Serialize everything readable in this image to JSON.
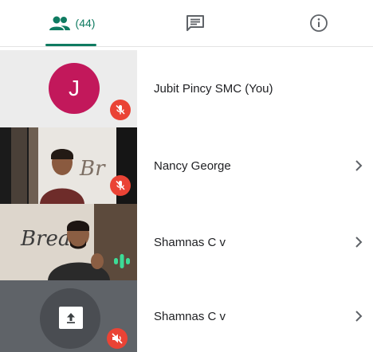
{
  "tabs": {
    "people": {
      "count": "(44)",
      "icon": "people-icon"
    },
    "chat": {
      "icon": "chat-icon"
    },
    "info": {
      "icon": "info-icon"
    }
  },
  "participants": [
    {
      "name": "Jubit Pincy SMC (You)",
      "avatar_letter": "J",
      "avatar_color": "#c2185b",
      "mic": "muted"
    },
    {
      "name": "Nancy George",
      "mic": "muted",
      "tile_text": "Br"
    },
    {
      "name": "Shamnas C v",
      "mic": "speaking",
      "tile_text": "Brea"
    },
    {
      "name": "Shamnas C v",
      "mic": "muted-audio",
      "screen_share": true
    }
  ],
  "colors": {
    "accent": "#0f7b61",
    "muted_badge": "#ea4335",
    "speaking": "#3ddc97"
  }
}
